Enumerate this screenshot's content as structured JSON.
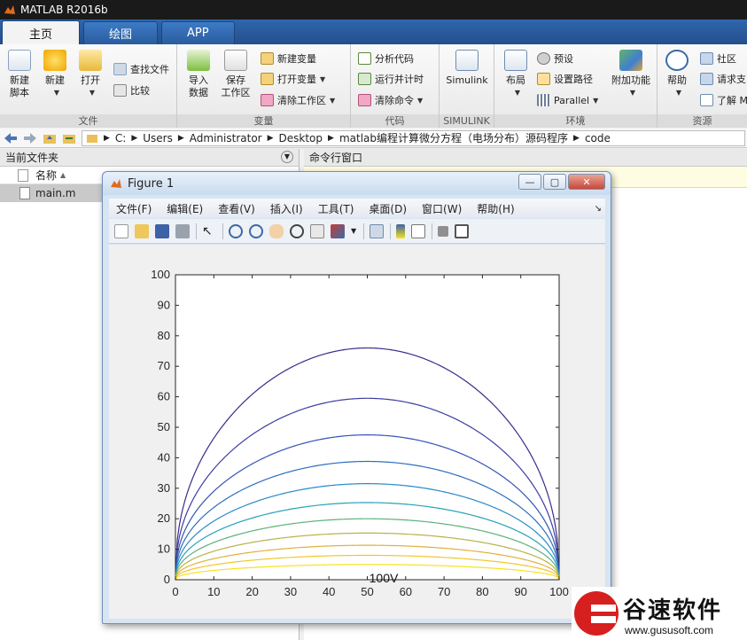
{
  "app": {
    "title": "MATLAB R2016b"
  },
  "tabs": [
    {
      "label": "主页"
    },
    {
      "label": "绘图"
    },
    {
      "label": "APP"
    }
  ],
  "ribbon": {
    "file": {
      "label": "文件",
      "new_script": "新建\n脚本",
      "new": "新建",
      "open": "打开",
      "find_files": "查找文件",
      "compare": "比较"
    },
    "variable": {
      "label": "变量",
      "import": "导入\n数据",
      "save": "保存\n工作区",
      "new_var": "新建变量",
      "open_var": "打开变量",
      "clear_ws": "清除工作区"
    },
    "code": {
      "label": "代码",
      "analyze": "分析代码",
      "run_time": "运行并计时",
      "clear_cmd": "清除命令"
    },
    "simulink": {
      "label": "SIMULINK",
      "btn": "Simulink"
    },
    "env": {
      "label": "环境",
      "layout": "布局",
      "prefs": "预设",
      "set_path": "设置路径",
      "parallel": "Parallel",
      "addons": "附加功能"
    },
    "resources": {
      "label": "资源",
      "help": "帮助",
      "community": "社区",
      "request": "请求支",
      "learn": "了解 M"
    }
  },
  "address": {
    "segments": [
      "C:",
      "Users",
      "Administrator",
      "Desktop",
      "matlab编程计算微分方程（电场分布）源码程序",
      "code"
    ]
  },
  "left_panel": {
    "title": "当前文件夹",
    "col_name": "名称",
    "file": "main.m"
  },
  "right_panel": {
    "title": "命令行窗口"
  },
  "figure": {
    "title": "Figure 1",
    "menu": [
      "文件(F)",
      "编辑(E)",
      "查看(V)",
      "插入(I)",
      "工具(T)",
      "桌面(D)",
      "窗口(W)",
      "帮助(H)"
    ]
  },
  "chart_data": {
    "type": "line",
    "title": "",
    "xlabel": "",
    "ylabel": "",
    "xlim": [
      0,
      100
    ],
    "ylim": [
      0,
      100
    ],
    "xticks": [
      0,
      10,
      20,
      30,
      40,
      50,
      60,
      70,
      80,
      90,
      100
    ],
    "yticks": [
      0,
      10,
      20,
      30,
      40,
      50,
      60,
      70,
      80,
      90,
      100
    ],
    "annotation": "100V",
    "grid": false,
    "series": [
      {
        "peak": 76.0,
        "color": "#3d2a8a"
      },
      {
        "peak": 59.5,
        "color": "#3e3ea3"
      },
      {
        "peak": 47.5,
        "color": "#3355b5"
      },
      {
        "peak": 38.8,
        "color": "#2e6fc0"
      },
      {
        "peak": 31.5,
        "color": "#2a8ac5"
      },
      {
        "peak": 25.3,
        "color": "#26a2b8"
      },
      {
        "peak": 20.0,
        "color": "#5fb07e"
      },
      {
        "peak": 15.3,
        "color": "#b6b347"
      },
      {
        "peak": 11.3,
        "color": "#e0b13a"
      },
      {
        "peak": 8.0,
        "color": "#f3c62a"
      },
      {
        "peak": 5.0,
        "color": "#f7e31b"
      }
    ],
    "x": [
      0,
      2,
      5,
      10,
      15,
      20,
      25,
      30,
      35,
      40,
      45,
      50,
      55,
      60,
      65,
      70,
      75,
      80,
      85,
      90,
      95,
      98,
      100
    ]
  },
  "watermark": {
    "brand": "谷速软件",
    "url": "www.gususoft.com",
    "color": "#d6201f"
  }
}
